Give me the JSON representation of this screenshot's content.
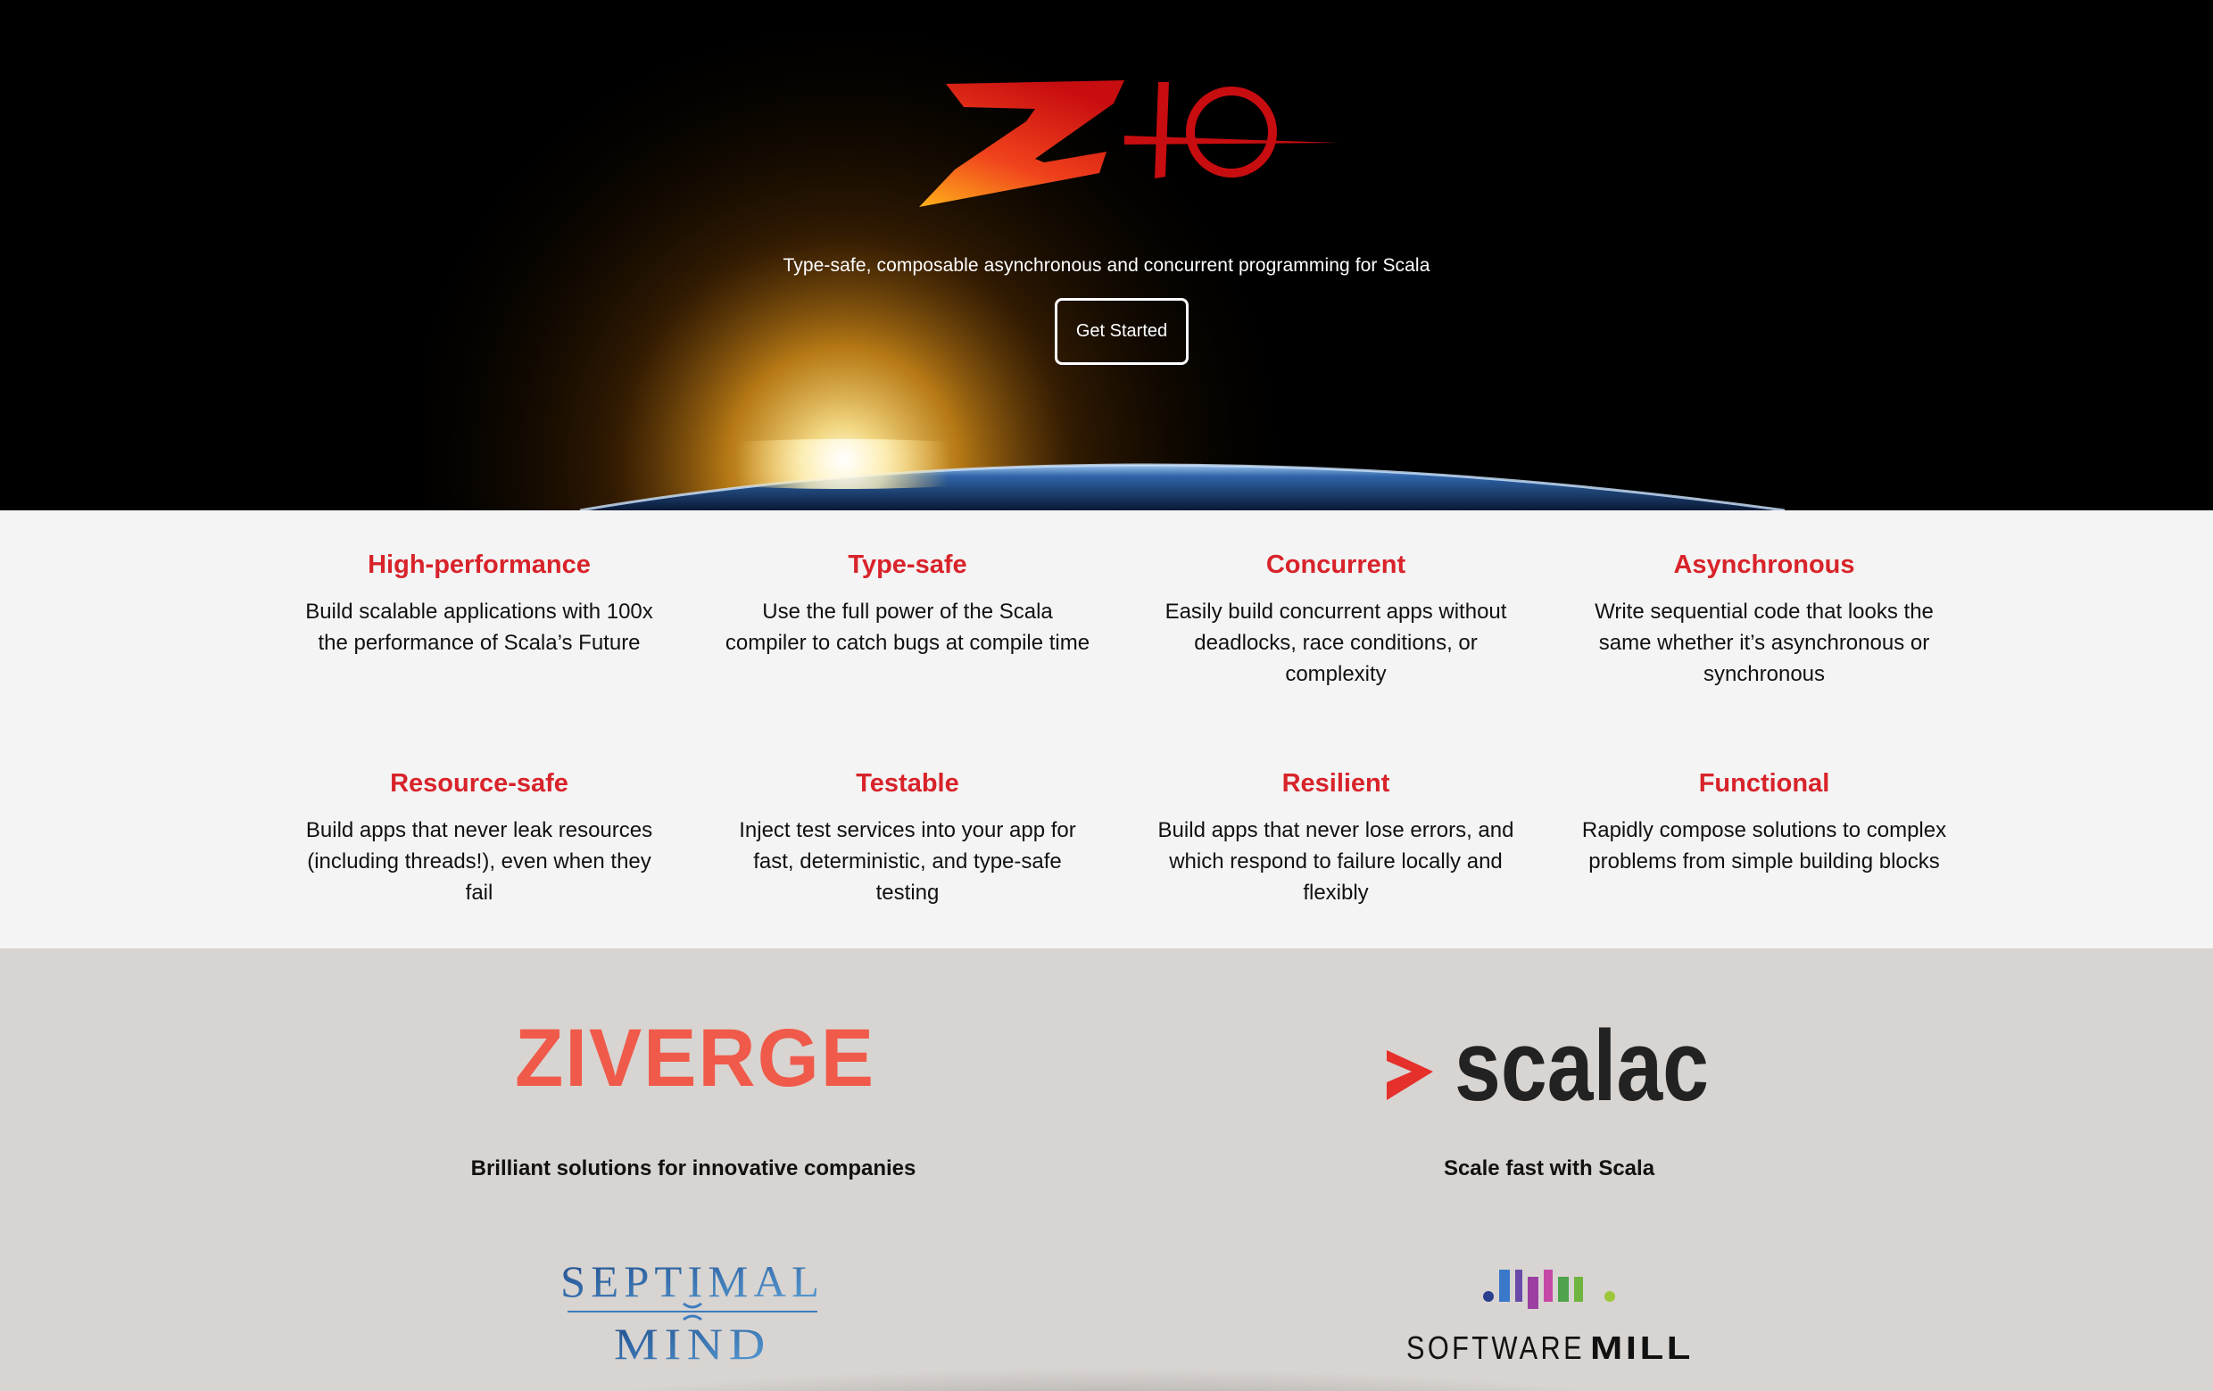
{
  "hero": {
    "logo_text": "ZIO",
    "tagline": "Type-safe, composable asynchronous and concurrent programming for Scala",
    "cta_label": "Get Started"
  },
  "features": [
    {
      "title": "High-performance",
      "text": "Build scalable applications with 100x the performance of Scala’s Future"
    },
    {
      "title": "Type-safe",
      "text": "Use the full power of the Scala compiler to catch bugs at compile time"
    },
    {
      "title": "Concurrent",
      "text": "Easily build concurrent apps without deadlocks, race conditions, or complexity"
    },
    {
      "title": "Asynchronous",
      "text": "Write sequential code that looks the same whether it’s asynchronous or synchronous"
    },
    {
      "title": "Resource-safe",
      "text": "Build apps that never leak resources (including threads!), even when they fail"
    },
    {
      "title": "Testable",
      "text": "Inject test services into your app for fast, deterministic, and type-safe testing"
    },
    {
      "title": "Resilient",
      "text": "Build apps that never lose errors, and which respond to failure locally and flexibly"
    },
    {
      "title": "Functional",
      "text": "Rapidly compose solutions to complex problems from simple building blocks"
    }
  ],
  "sponsors": {
    "ziverge": {
      "logo_text": "ZIVERGE",
      "caption": "Brilliant solutions for innovative companies"
    },
    "scalac": {
      "logo_text": "scalac",
      "caption": "Scale fast with Scala"
    },
    "septimal": {
      "logo_line1": "SEPTIMAL",
      "logo_line2": "MIND"
    },
    "softwaremill": {
      "logo_light": "SOFTWARE",
      "logo_bold": "MILL"
    }
  },
  "colors": {
    "accent_red": "#d8232a",
    "ziverge_orange": "#f05a4a",
    "scalac_red": "#e5302b",
    "hero_bg": "#000000",
    "features_bg": "#f4f4f4",
    "sponsors_bg": "#d8d4d1"
  }
}
